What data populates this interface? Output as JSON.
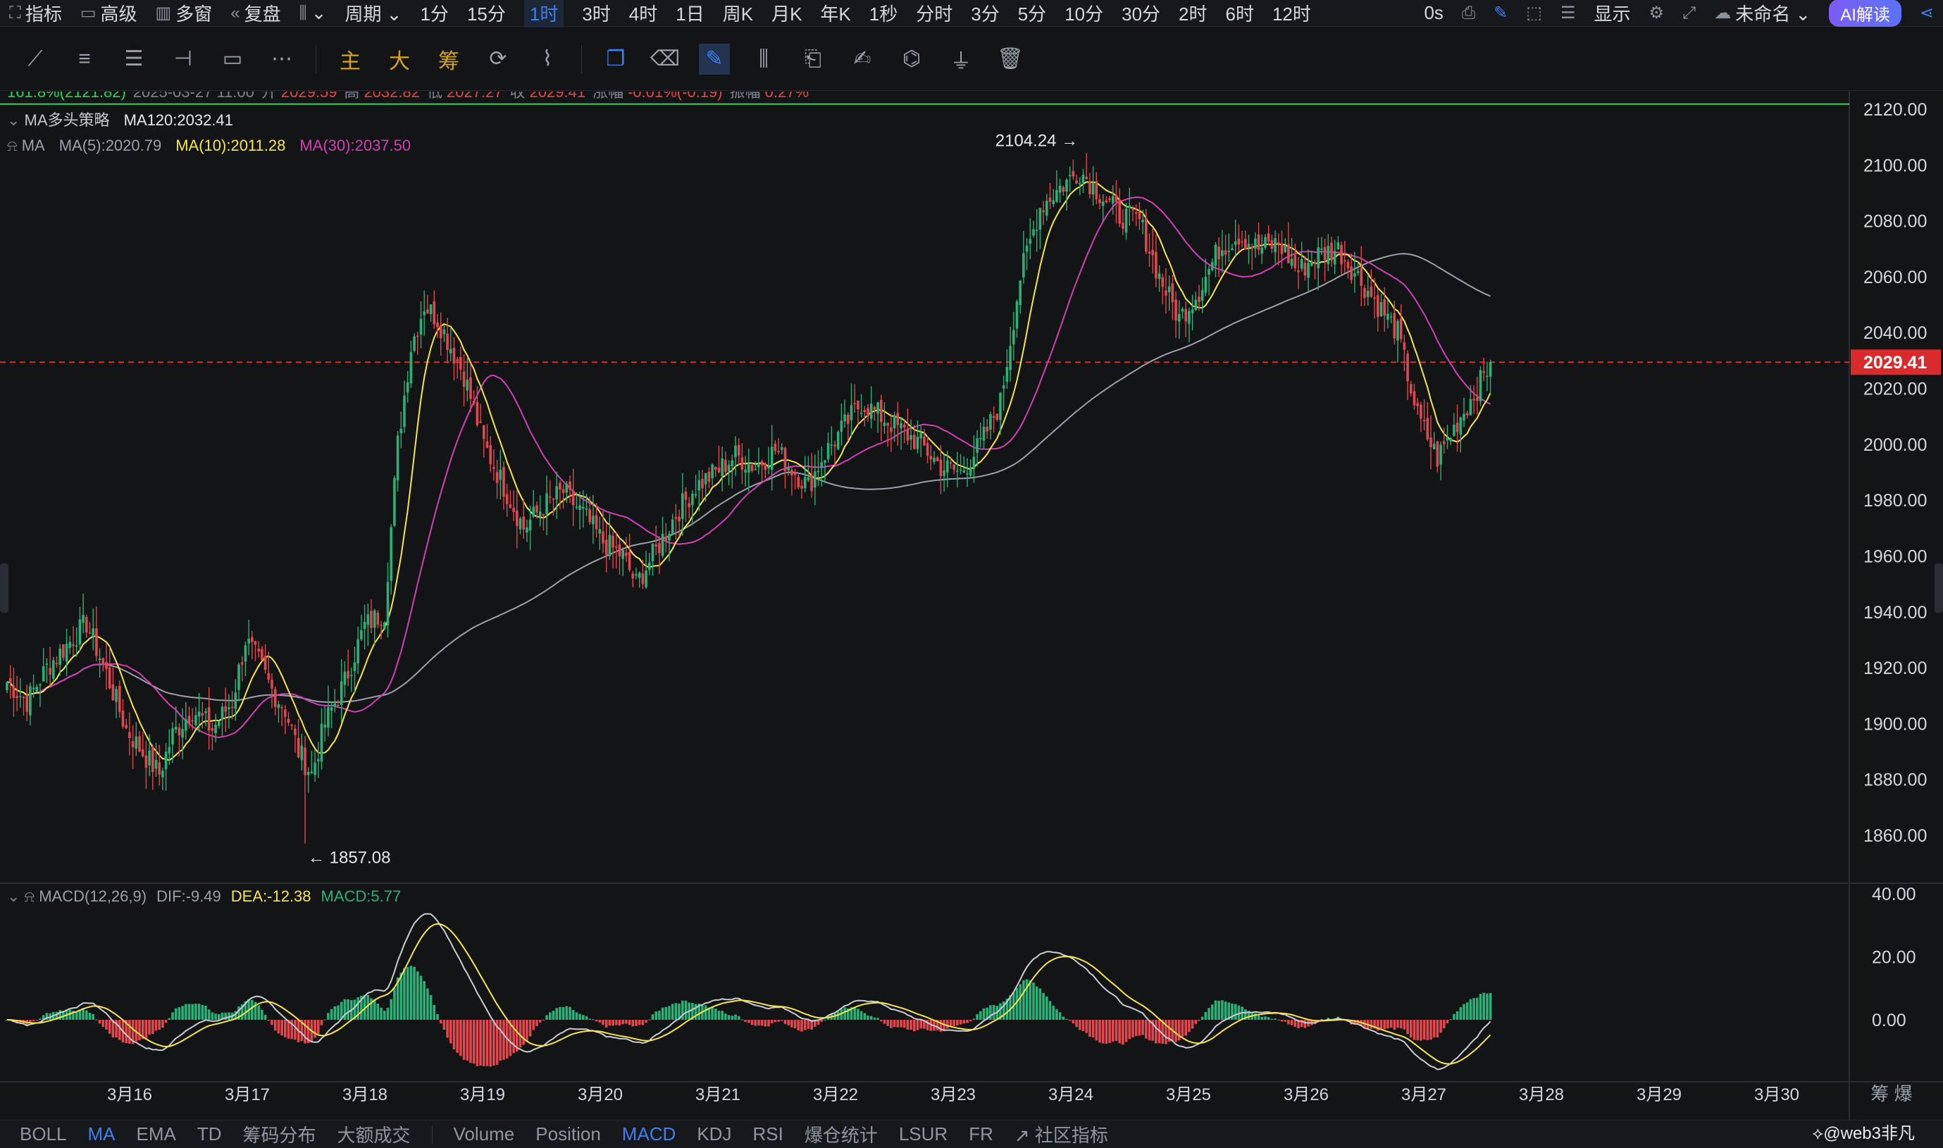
{
  "topbar": {
    "left": [
      {
        "icon": "indicator-icon",
        "glyph": "⛶",
        "label": "指标"
      },
      {
        "icon": "advanced-icon",
        "glyph": "▭",
        "label": "高级"
      },
      {
        "icon": "multi-window-icon",
        "glyph": "▥",
        "label": "多窗"
      },
      {
        "icon": "replay-icon",
        "glyph": "«",
        "label": "复盘"
      },
      {
        "icon": "candle-type-icon",
        "glyph": "⫼",
        "label": "⌄"
      },
      {
        "icon": "",
        "glyph": "",
        "label": "周期 ⌄"
      }
    ],
    "intervals": [
      "1分",
      "15分",
      "1时",
      "3时",
      "4时",
      "1日",
      "周K",
      "月K",
      "年K",
      "1秒",
      "分时",
      "3分",
      "5分",
      "10分",
      "30分",
      "2时",
      "6时",
      "12时"
    ],
    "active_interval": "1时",
    "right": {
      "timer": "0s",
      "display": "显示",
      "unnamed": "未命名 ⌄",
      "ai": "AI解读"
    }
  },
  "tools": {
    "gold": [
      "主",
      "大",
      "筹"
    ]
  },
  "info": {
    "fib": "161.8%(2121.82)",
    "ohlc_date": "2025-03-27 11:00",
    "open_label": "开",
    "open": "2029.59",
    "high_label": "高",
    "high": "2032.82",
    "low_label": "低",
    "low": "2027.27",
    "close_label": "收",
    "close": "2029.41",
    "change_label": "涨幅",
    "change": "-0.01%(-0.19)",
    "amp_label": "振幅",
    "amp": "0.27%",
    "strategy": "MA多头策略",
    "ma120": "MA120:2032.41",
    "ma_label": "MA",
    "ma5": "MA(5):2020.79",
    "ma10": "MA(10):2011.28",
    "ma30": "MA(30):2037.50",
    "macd_label": "MACD(12,26,9)",
    "dif": "DIF:-9.49",
    "dea": "DEA:-12.38",
    "macd": "MACD:5.77",
    "current_price": "2029.41",
    "max_label": "2104.24",
    "min_label": "1857.08",
    "side_text": "筹 爆"
  },
  "colors": {
    "up": "#2bb077",
    "down": "#e1474c",
    "ma5": "#f5e64a",
    "ma10": "#f5e64a",
    "ma30": "#d23fb5",
    "ma120": "#9aa0aa",
    "dif": "#c9ccd3",
    "dea": "#f5e64a",
    "accent": "#3d7ef0",
    "price_tag": "#d92b2b",
    "fib": "#2fd35a"
  },
  "chart_data": {
    "type": "candlestick",
    "interval": "1时",
    "price_axis": {
      "min": 1850,
      "max": 2125,
      "ticks": [
        2120,
        2100,
        2080,
        2060,
        2040,
        2020,
        2000,
        1980,
        1960,
        1940,
        1920,
        1900,
        1880,
        1860
      ]
    },
    "macd_axis": {
      "min": -18,
      "max": 42,
      "ticks": [
        40,
        20,
        0
      ]
    },
    "date_ticks": [
      "3月16",
      "3月17",
      "3月18",
      "3月19",
      "3月20",
      "3月21",
      "3月22",
      "3月23",
      "3月24",
      "3月25",
      "3月26",
      "3月27",
      "3月28",
      "3月29",
      "3月30"
    ],
    "current_price": 2029.41,
    "high_marker": 2104.24,
    "low_marker": 1857.08,
    "fib_level": 2121.82,
    "close_keypoints": [
      [
        0,
        1915
      ],
      [
        6,
        1908
      ],
      [
        12,
        1920
      ],
      [
        18,
        1928
      ],
      [
        24,
        1936
      ],
      [
        30,
        1918
      ],
      [
        36,
        1898
      ],
      [
        42,
        1888
      ],
      [
        46,
        1882
      ],
      [
        50,
        1896
      ],
      [
        56,
        1905
      ],
      [
        62,
        1898
      ],
      [
        68,
        1908
      ],
      [
        72,
        1930
      ],
      [
        76,
        1922
      ],
      [
        80,
        1912
      ],
      [
        84,
        1905
      ],
      [
        88,
        1890
      ],
      [
        92,
        1882
      ],
      [
        96,
        1900
      ],
      [
        102,
        1915
      ],
      [
        108,
        1935
      ],
      [
        114,
        1940
      ],
      [
        118,
        2000
      ],
      [
        122,
        2035
      ],
      [
        126,
        2050
      ],
      [
        130,
        2045
      ],
      [
        134,
        2035
      ],
      [
        138,
        2025
      ],
      [
        144,
        2000
      ],
      [
        150,
        1985
      ],
      [
        156,
        1970
      ],
      [
        162,
        1978
      ],
      [
        168,
        1983
      ],
      [
        174,
        1975
      ],
      [
        180,
        1965
      ],
      [
        186,
        1960
      ],
      [
        190,
        1950
      ],
      [
        196,
        1962
      ],
      [
        202,
        1975
      ],
      [
        208,
        1985
      ],
      [
        214,
        1990
      ],
      [
        220,
        1996
      ],
      [
        226,
        1992
      ],
      [
        232,
        1998
      ],
      [
        238,
        1990
      ],
      [
        242,
        1985
      ],
      [
        246,
        1995
      ],
      [
        252,
        2005
      ],
      [
        258,
        2015
      ],
      [
        264,
        2010
      ],
      [
        270,
        2005
      ],
      [
        276,
        2000
      ],
      [
        282,
        1992
      ],
      [
        288,
        1990
      ],
      [
        294,
        2000
      ],
      [
        300,
        2015
      ],
      [
        306,
        2060
      ],
      [
        312,
        2085
      ],
      [
        318,
        2092
      ],
      [
        324,
        2098
      ],
      [
        330,
        2090
      ],
      [
        336,
        2082
      ],
      [
        342,
        2080
      ],
      [
        348,
        2060
      ],
      [
        354,
        2045
      ],
      [
        360,
        2055
      ],
      [
        366,
        2070
      ],
      [
        372,
        2075
      ],
      [
        378,
        2070
      ],
      [
        384,
        2072
      ],
      [
        390,
        2062
      ],
      [
        396,
        2068
      ],
      [
        402,
        2070
      ],
      [
        408,
        2060
      ],
      [
        414,
        2050
      ],
      [
        420,
        2040
      ],
      [
        426,
        2010
      ],
      [
        432,
        1995
      ],
      [
        438,
        2008
      ],
      [
        444,
        2020
      ],
      [
        448,
        2029
      ]
    ],
    "candle_count": 449
  }
}
